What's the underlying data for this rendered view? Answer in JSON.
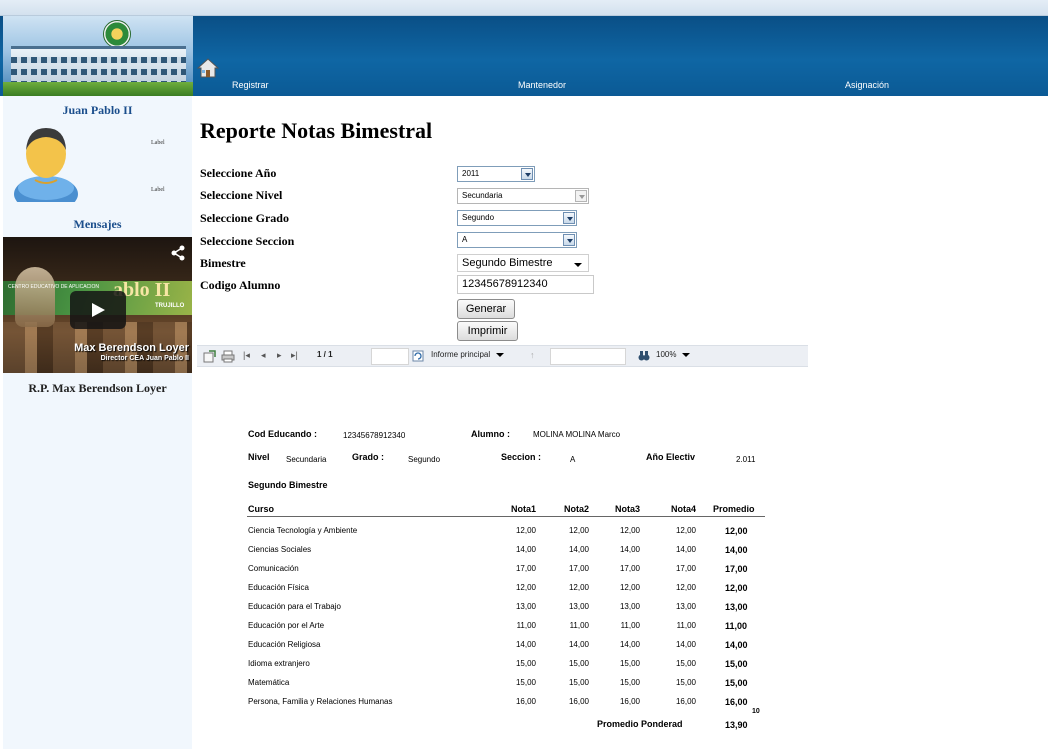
{
  "header": {
    "nav": [
      "Registrar",
      "Mantenedor",
      "Asignación"
    ]
  },
  "sidebar": {
    "school_name": "Juan Pablo II",
    "label1": "Label",
    "label2": "Label",
    "messages_title": "Mensajes",
    "video": {
      "banner_text": "ablo II",
      "banner_small": "CENTRO EDUCATIVO DE APLICACION",
      "city": "TRUJILLO",
      "caption_name": "Max Berendson Loyer",
      "caption_role": "Director CEA Juan Pablo II"
    },
    "director": "R.P. Max Berendson Loyer"
  },
  "form": {
    "title": "Reporte Notas Bimestral",
    "labels": {
      "year": "Seleccione Año",
      "level": "Seleccione Nivel",
      "grade": "Seleccione Grado",
      "section": "Seleccione Seccion",
      "bimester": "Bimestre",
      "student_code": "Codigo Alumno"
    },
    "values": {
      "year": "2011",
      "level": "Secundaria",
      "grade": "Segundo",
      "section": "A",
      "bimester": "Segundo Bimestre",
      "student_code": "12345678912340"
    },
    "buttons": {
      "generate": "Generar",
      "print": "Imprimir"
    }
  },
  "toolbar": {
    "page": "1 / 1",
    "report_select": "Informe principal",
    "zoom": "100%"
  },
  "report": {
    "cod_label": "Cod Educando :",
    "cod_value": "12345678912340",
    "student_label": "Alumno :",
    "student_value": "MOLINA MOLINA Marco",
    "level_label": "Nivel",
    "level_value": "Secundaria",
    "grade_label": "Grado :",
    "grade_value": "Segundo",
    "section_label": "Seccion :",
    "section_value": "A",
    "year_label": "Año Electiv",
    "year_value": "2.011",
    "bimester": "Segundo Bimestre",
    "columns": [
      "Curso",
      "Nota1",
      "Nota2",
      "Nota3",
      "Nota4",
      "Promedio"
    ],
    "rows": [
      [
        "Ciencia Tecnología y Ambiente",
        "12,00",
        "12,00",
        "12,00",
        "12,00",
        "12,00"
      ],
      [
        "Ciencias Sociales",
        "14,00",
        "14,00",
        "14,00",
        "14,00",
        "14,00"
      ],
      [
        "Comunicación",
        "17,00",
        "17,00",
        "17,00",
        "17,00",
        "17,00"
      ],
      [
        "Educación Física",
        "12,00",
        "12,00",
        "12,00",
        "12,00",
        "12,00"
      ],
      [
        "Educación para el Trabajo",
        "13,00",
        "13,00",
        "13,00",
        "13,00",
        "13,00"
      ],
      [
        "Educación por el Arte",
        "11,00",
        "11,00",
        "11,00",
        "11,00",
        "11,00"
      ],
      [
        "Educación Religiosa",
        "14,00",
        "14,00",
        "14,00",
        "14,00",
        "14,00"
      ],
      [
        "Idioma extranjero",
        "15,00",
        "15,00",
        "15,00",
        "15,00",
        "15,00"
      ],
      [
        "Matemática",
        "15,00",
        "15,00",
        "15,00",
        "15,00",
        "15,00"
      ],
      [
        "Persona, Familia y Relaciones Humanas",
        "16,00",
        "16,00",
        "16,00",
        "16,00",
        "16,00"
      ]
    ],
    "weighted_label": "Promedio Ponderad",
    "weighted_value": "13,90",
    "weighted_sup": "10"
  }
}
